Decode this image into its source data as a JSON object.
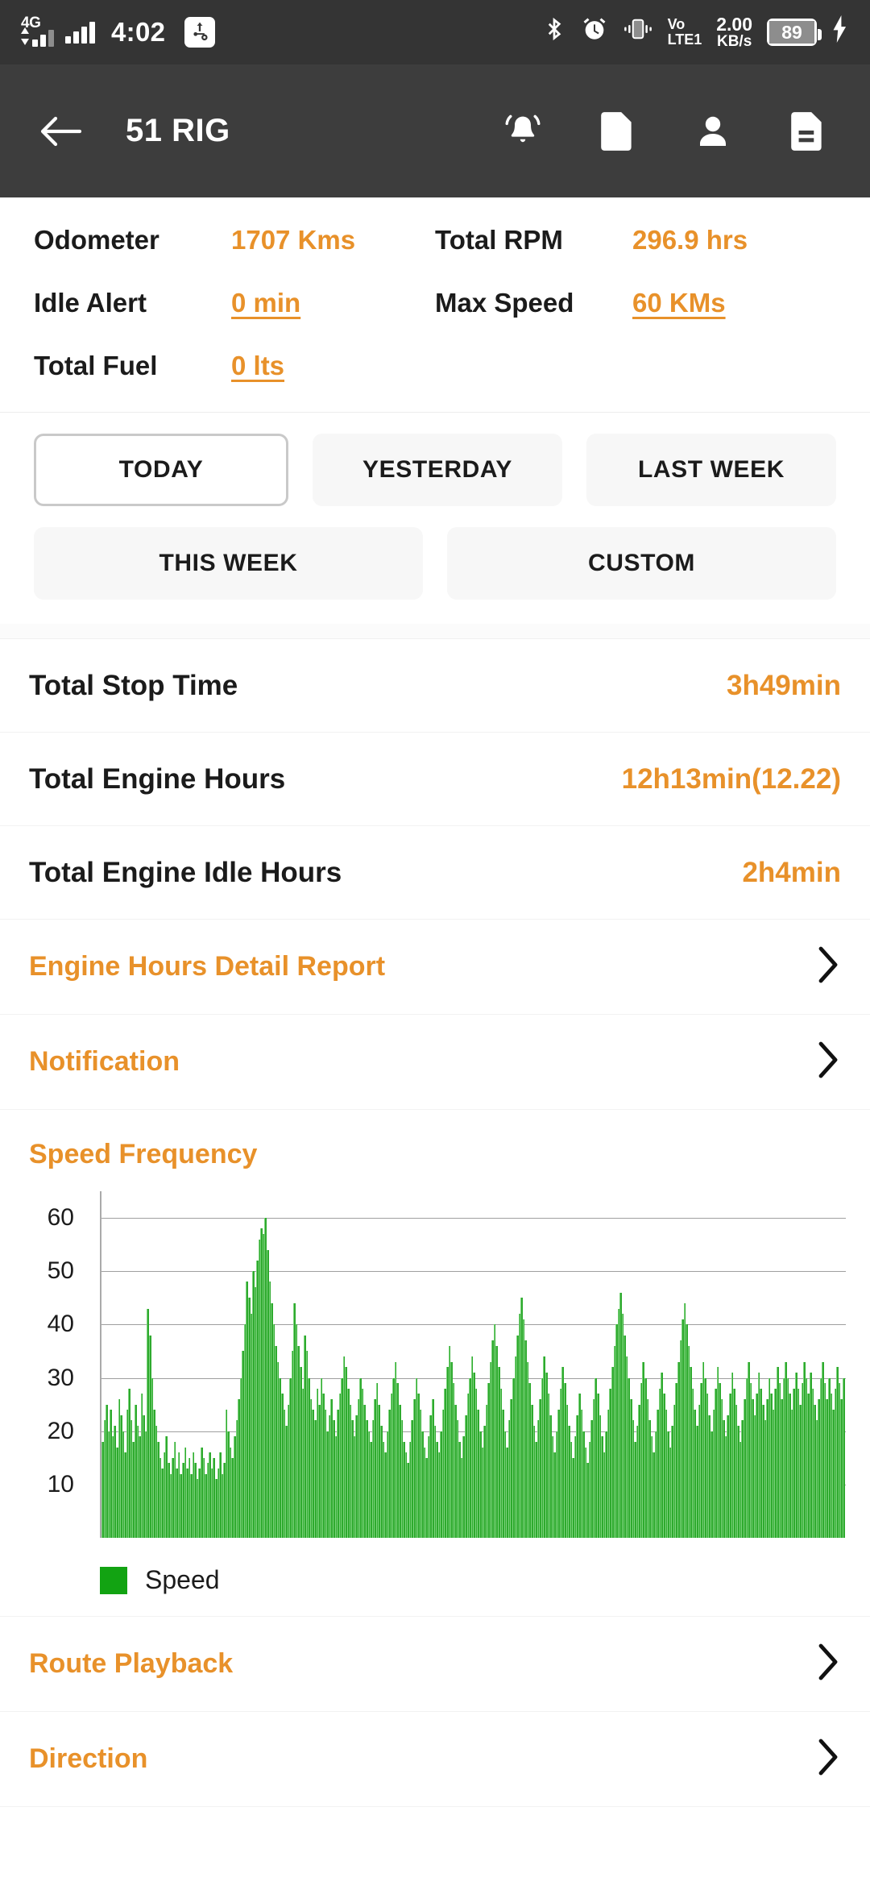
{
  "statusbar": {
    "network_type": "4G",
    "time": "4:02",
    "usb_icon": "usb-settings-icon",
    "bluetooth_icon": "bluetooth-icon",
    "alarm_icon": "alarm-clock-icon",
    "vibrate_icon": "vibrate-icon",
    "volte_line1": "Vo",
    "volte_line2": "LTE1",
    "data_rate_value": "2.00",
    "data_rate_unit": "KB/s",
    "battery_level": "89",
    "charging_icon": "charging-bolt-icon"
  },
  "appbar": {
    "back_icon": "back-arrow-icon",
    "title": "51 RIG",
    "actions": [
      {
        "name": "notification-bell-icon"
      },
      {
        "name": "document-icon"
      },
      {
        "name": "person-icon"
      },
      {
        "name": "report-document-icon"
      }
    ]
  },
  "stats": [
    [
      {
        "label": "Odometer",
        "value": "1707 Kms",
        "underlined": false
      },
      {
        "label": "Total RPM",
        "value": "296.9 hrs",
        "underlined": false
      }
    ],
    [
      {
        "label": "Idle Alert",
        "value": "0 min",
        "underlined": true
      },
      {
        "label": "Max Speed",
        "value": "60 KMs",
        "underlined": true
      }
    ],
    [
      {
        "label": "Total Fuel",
        "value": "0 lts",
        "underlined": true
      },
      {
        "label": "",
        "value": "",
        "underlined": false
      }
    ]
  ],
  "periods": {
    "row1": [
      {
        "label": "TODAY",
        "selected": true
      },
      {
        "label": "YESTERDAY",
        "selected": false
      },
      {
        "label": "LAST WEEK",
        "selected": false
      }
    ],
    "row2": [
      {
        "label": "THIS WEEK",
        "selected": false
      },
      {
        "label": "CUSTOM",
        "selected": false
      }
    ]
  },
  "summary": [
    {
      "label": "Total Stop Time",
      "value": "3h49min"
    },
    {
      "label": "Total Engine Hours",
      "value": "12h13min(12.22)"
    },
    {
      "label": "Total Engine Idle Hours",
      "value": "2h4min"
    }
  ],
  "links_top": [
    {
      "label": "Engine Hours Detail Report",
      "chevron": "chevron-right-icon"
    },
    {
      "label": "Notification",
      "chevron": "chevron-right-icon"
    }
  ],
  "links_bottom": [
    {
      "label": "Route Playback",
      "chevron": "chevron-right-icon"
    },
    {
      "label": "Direction",
      "chevron": "chevron-right-icon"
    }
  ],
  "chart_data": {
    "type": "bar",
    "title": "Speed Frequency",
    "xlabel": "",
    "ylabel": "",
    "ylim": [
      0,
      65
    ],
    "yticks": [
      10,
      20,
      30,
      40,
      50,
      60
    ],
    "grid": true,
    "legend_position": "bottom-left",
    "series": [
      {
        "name": "Speed",
        "color": "#2eaa2e"
      }
    ],
    "values": [
      18,
      22,
      25,
      20,
      24,
      19,
      21,
      17,
      26,
      23,
      20,
      16,
      24,
      28,
      22,
      18,
      25,
      21,
      19,
      27,
      23,
      20,
      43,
      38,
      30,
      24,
      21,
      18,
      15,
      13,
      16,
      19,
      14,
      12,
      15,
      18,
      13,
      16,
      12,
      14,
      17,
      13,
      15,
      12,
      16,
      14,
      11,
      13,
      17,
      15,
      12,
      14,
      16,
      13,
      15,
      11,
      13,
      16,
      12,
      14,
      24,
      20,
      17,
      15,
      19,
      22,
      26,
      30,
      35,
      40,
      48,
      45,
      42,
      50,
      47,
      52,
      56,
      58,
      57,
      60,
      54,
      48,
      44,
      40,
      36,
      33,
      30,
      27,
      24,
      21,
      25,
      30,
      35,
      44,
      40,
      36,
      32,
      28,
      38,
      35,
      30,
      26,
      24,
      22,
      28,
      25,
      30,
      27,
      24,
      20,
      23,
      26,
      22,
      19,
      24,
      27,
      30,
      34,
      32,
      28,
      25,
      22,
      19,
      23,
      26,
      30,
      28,
      25,
      22,
      20,
      18,
      22,
      26,
      29,
      25,
      21,
      18,
      16,
      20,
      24,
      27,
      30,
      33,
      29,
      25,
      22,
      18,
      16,
      14,
      18,
      22,
      26,
      30,
      27,
      24,
      20,
      17,
      15,
      19,
      23,
      26,
      21,
      18,
      16,
      20,
      24,
      28,
      32,
      36,
      33,
      29,
      25,
      22,
      18,
      15,
      19,
      23,
      27,
      30,
      34,
      31,
      28,
      24,
      20,
      17,
      21,
      25,
      29,
      33,
      37,
      40,
      36,
      32,
      28,
      24,
      20,
      17,
      22,
      26,
      30,
      34,
      38,
      42,
      45,
      41,
      37,
      33,
      29,
      25,
      21,
      18,
      22,
      26,
      30,
      34,
      31,
      27,
      23,
      19,
      16,
      20,
      24,
      28,
      32,
      29,
      25,
      21,
      18,
      15,
      19,
      23,
      27,
      24,
      20,
      17,
      14,
      18,
      22,
      26,
      30,
      27,
      23,
      19,
      16,
      20,
      24,
      28,
      32,
      36,
      40,
      43,
      46,
      42,
      38,
      34,
      30,
      26,
      22,
      18,
      21,
      25,
      29,
      33,
      30,
      26,
      22,
      19,
      16,
      20,
      24,
      28,
      31,
      27,
      24,
      20,
      17,
      21,
      25,
      29,
      33,
      37,
      41,
      44,
      40,
      36,
      32,
      28,
      24,
      21,
      25,
      29,
      33,
      30,
      27,
      23,
      20,
      24,
      28,
      32,
      29,
      26,
      22,
      19,
      23,
      27,
      31,
      28,
      25,
      21,
      18,
      22,
      26,
      30,
      33,
      29,
      26,
      23,
      27,
      31,
      28,
      25,
      22,
      26,
      30,
      27,
      24,
      28,
      32,
      29,
      26,
      30,
      33,
      30,
      27,
      24,
      28,
      31,
      28,
      25,
      29,
      33,
      30,
      27,
      31,
      28,
      25,
      22,
      26,
      30,
      33,
      29,
      26,
      30,
      27,
      24,
      28,
      32,
      29,
      26,
      30
    ]
  }
}
